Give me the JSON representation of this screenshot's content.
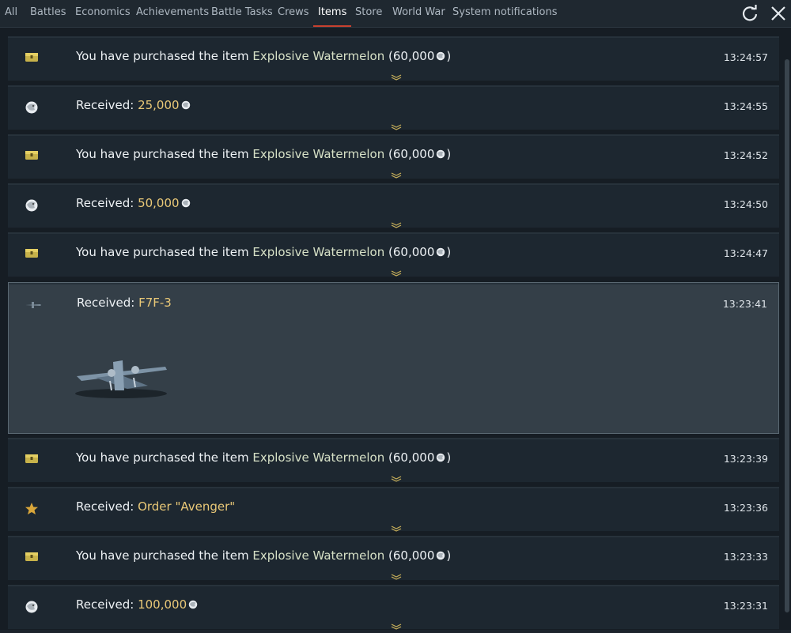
{
  "tabs": [
    {
      "label": "All",
      "active": false
    },
    {
      "label": "Battles",
      "active": false
    },
    {
      "label": "Economics",
      "active": false
    },
    {
      "label": "Achievements",
      "active": false
    },
    {
      "label": "Battle Tasks",
      "active": false
    },
    {
      "label": "Crews",
      "active": false
    },
    {
      "label": "Items",
      "active": true
    },
    {
      "label": "Store",
      "active": false
    },
    {
      "label": "World War",
      "active": false
    },
    {
      "label": "System notifications",
      "active": false
    }
  ],
  "toolbar": {
    "refresh_icon": "refresh-icon",
    "close_icon": "close-icon"
  },
  "colors": {
    "highlight": "#e9c877",
    "active_tab_underline": "#c8412f",
    "row_bg": "#1d2730",
    "expanded_bg": "#343f48"
  },
  "rows": [
    {
      "icon": "chest-icon",
      "prefix": "You have purchased the item ",
      "item": "Explosive Watermelon",
      "amount": "(60,000",
      "suffix": ")",
      "time": "13:24:57"
    },
    {
      "icon": "lion-icon",
      "prefix": "Received: ",
      "item": "25,000",
      "time": "13:24:55"
    },
    {
      "icon": "chest-icon",
      "prefix": "You have purchased the item ",
      "item": "Explosive Watermelon",
      "amount": "(60,000",
      "suffix": ")",
      "time": "13:24:52"
    },
    {
      "icon": "lion-icon",
      "prefix": "Received: ",
      "item": "50,000",
      "time": "13:24:50"
    },
    {
      "icon": "chest-icon",
      "prefix": "You have purchased the item ",
      "item": "Explosive Watermelon",
      "amount": "(60,000",
      "suffix": ")",
      "time": "13:24:47"
    },
    {
      "icon": "aircraft-icon",
      "prefix": "Received: ",
      "item": "F7F-3",
      "time": "13:23:41"
    },
    {
      "icon": "chest-icon",
      "prefix": "You have purchased the item ",
      "item": "Explosive Watermelon",
      "amount": "(60,000",
      "suffix": ")",
      "time": "13:23:39"
    },
    {
      "icon": "star-icon",
      "prefix": "Received: ",
      "item": "Order \"Avenger\"",
      "time": "13:23:36"
    },
    {
      "icon": "chest-icon",
      "prefix": "You have purchased the item ",
      "item": "Explosive Watermelon",
      "amount": "(60,000",
      "suffix": ")",
      "time": "13:23:33"
    },
    {
      "icon": "lion-icon",
      "prefix": "Received: ",
      "item": "100,000",
      "time": "13:23:31"
    }
  ]
}
